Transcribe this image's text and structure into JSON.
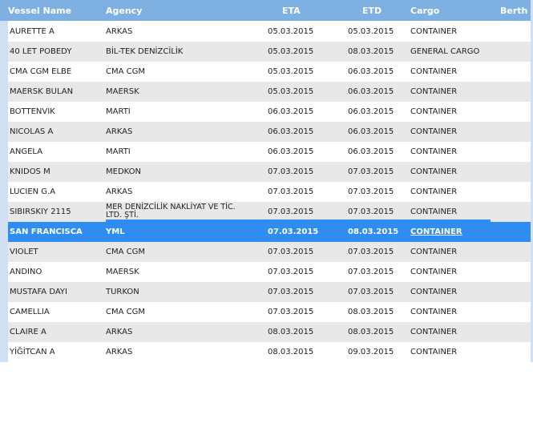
{
  "table": {
    "headers": {
      "vessel": "Vessel Name",
      "agency": "Agency",
      "eta": "ETA",
      "etd": "ETD",
      "cargo": "Cargo",
      "berth": "Berth"
    },
    "rows": [
      {
        "vessel": "AURETTE A",
        "agency": "ARKAS",
        "eta": "05.03.2015",
        "etd": "05.03.2015",
        "cargo": "CONTAINER"
      },
      {
        "vessel": "40 LET POBEDY",
        "agency": "BİL-TEK DENİZCİLİK",
        "eta": "05.03.2015",
        "etd": "08.03.2015",
        "cargo": "GENERAL CARGO"
      },
      {
        "vessel": "CMA CGM ELBE",
        "agency": "CMA CGM",
        "eta": "05.03.2015",
        "etd": "06.03.2015",
        "cargo": "CONTAINER"
      },
      {
        "vessel": "MAERSK BULAN",
        "agency": "MAERSK",
        "eta": "05.03.2015",
        "etd": "06.03.2015",
        "cargo": "CONTAINER"
      },
      {
        "vessel": "BOTTENVIK",
        "agency": "MARTI",
        "eta": "06.03.2015",
        "etd": "06.03.2015",
        "cargo": "CONTAINER"
      },
      {
        "vessel": "NICOLAS A",
        "agency": "ARKAS",
        "eta": "06.03.2015",
        "etd": "06.03.2015",
        "cargo": "CONTAINER"
      },
      {
        "vessel": "ANGELA",
        "agency": "MARTI",
        "eta": "06.03.2015",
        "etd": "06.03.2015",
        "cargo": "CONTAINER"
      },
      {
        "vessel": "KNIDOS M",
        "agency": "MEDKON",
        "eta": "07.03.2015",
        "etd": "07.03.2015",
        "cargo": "CONTAINER"
      },
      {
        "vessel": "LUCIEN G.A",
        "agency": "ARKAS",
        "eta": "07.03.2015",
        "etd": "07.03.2015",
        "cargo": "CONTAINER"
      },
      {
        "vessel": "SIBIRSKIY 2115",
        "agency": "MER DENİZCİLİK NAKLİYAT VE TİC. LTD. ŞTİ.",
        "eta": "07.03.2015",
        "etd": "07.03.2015",
        "cargo": "CONTAINER"
      },
      {
        "vessel": "SAN FRANCISCA",
        "agency": "YML",
        "eta": "07.03.2015",
        "etd": "08.03.2015",
        "cargo": "CONTAINER"
      },
      {
        "vessel": "VIOLET",
        "agency": "CMA CGM",
        "eta": "07.03.2015",
        "etd": "07.03.2015",
        "cargo": "CONTAINER"
      },
      {
        "vessel": "ANDINO",
        "agency": "MAERSK",
        "eta": "07.03.2015",
        "etd": "07.03.2015",
        "cargo": "CONTAINER"
      },
      {
        "vessel": "MUSTAFA DAYI",
        "agency": "TURKON",
        "eta": "07.03.2015",
        "etd": "07.03.2015",
        "cargo": "CONTAINER"
      },
      {
        "vessel": "CAMELLIA",
        "agency": "CMA CGM",
        "eta": "07.03.2015",
        "etd": "08.03.2015",
        "cargo": "CONTAINER"
      },
      {
        "vessel": "CLAIRE A",
        "agency": "ARKAS",
        "eta": "08.03.2015",
        "etd": "08.03.2015",
        "cargo": "CONTAINER"
      },
      {
        "vessel": "YİĞİTCAN A",
        "agency": "ARKAS",
        "eta": "08.03.2015",
        "etd": "09.03.2015",
        "cargo": "CONTAINER"
      }
    ],
    "selected_row_vessel": "SAN FRANCISCA"
  },
  "colors": {
    "header_bg": "#7eb0e2",
    "selected_bg": "#2f8cf0",
    "stripe_bg": "#e8e8e8",
    "edge": "#cfe0f3"
  }
}
